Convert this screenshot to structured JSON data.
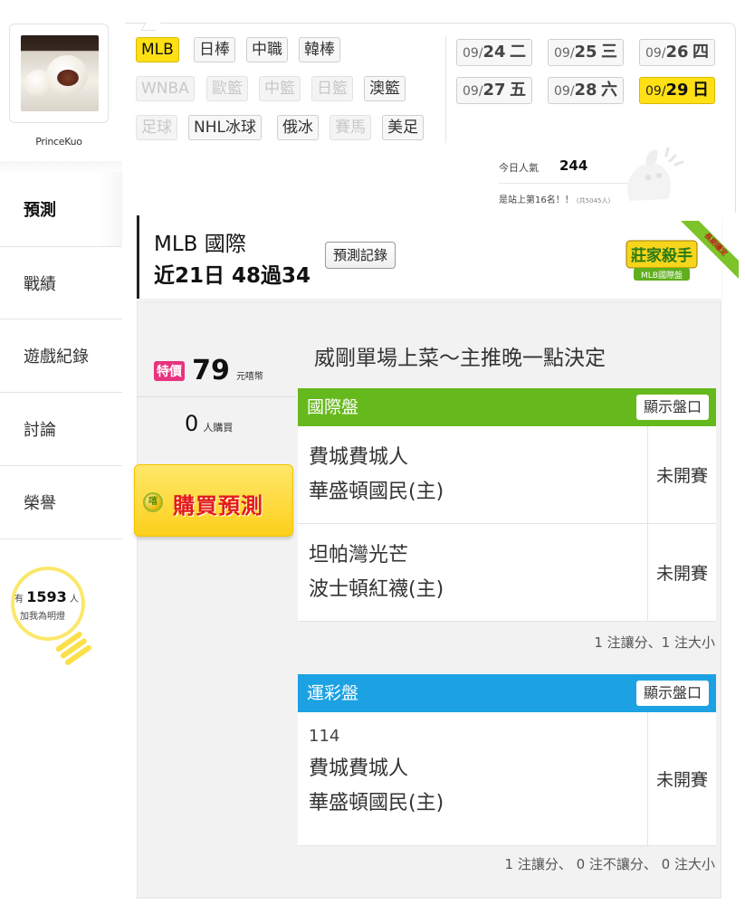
{
  "user": {
    "name": "PrinceKuo"
  },
  "nav": {
    "predict": "預測",
    "record": "戰績",
    "gamelog": "遊戲紀錄",
    "discuss": "討論",
    "honor": "榮譽"
  },
  "fans": {
    "prefix": "有",
    "count": "1593",
    "suffix": "人",
    "caption": "加我為明燈"
  },
  "categories": {
    "mlb": "MLB",
    "npb": "日棒",
    "cpbl": "中職",
    "kbo": "韓棒",
    "wnba": "WNBA",
    "euro_bb": "歐籃",
    "cn_bb": "中籃",
    "jp_bb": "日籃",
    "au_bb": "澳籃",
    "soccer": "足球",
    "nhl": "NHL冰球",
    "khl": "俄冰",
    "horse": "賽馬",
    "nfl": "美足"
  },
  "dates": [
    {
      "md": "09/",
      "d": "24",
      "wd": "二"
    },
    {
      "md": "09/",
      "d": "25",
      "wd": "三"
    },
    {
      "md": "09/",
      "d": "26",
      "wd": "四"
    },
    {
      "md": "09/",
      "d": "27",
      "wd": "五"
    },
    {
      "md": "09/",
      "d": "28",
      "wd": "六"
    },
    {
      "md": "09/",
      "d": "29",
      "wd": "日"
    }
  ],
  "popularity": {
    "label": "今日人氣",
    "value": "244",
    "rank_text": "是站上第16名！！",
    "rank_total": "(共5045人)"
  },
  "header": {
    "league": "MLB 國際",
    "record": "近21日 48過34",
    "history_button": "預測記錄",
    "badge_main": "莊家殺手",
    "badge_sub": "MLB國際盤",
    "badge_ribbon": "長期穩定"
  },
  "offer": {
    "sale_tag": "特價",
    "price": "79",
    "price_unit": "元嘻幣",
    "buyers": "0",
    "buyers_unit": "人購買",
    "buy_button": "購買預測",
    "coin_glyph": "嘻"
  },
  "pick_title": "威剛單場上菜～主推晚一點決定",
  "intl_market": {
    "title": "國際盤",
    "show_button": "顯示盤口",
    "games": [
      {
        "away": "費城費城人",
        "home": "華盛頓國民(主)",
        "status": "未開賽"
      },
      {
        "away": "坦帕灣光芒",
        "home": "波士頓紅襪(主)",
        "status": "未開賽"
      }
    ],
    "summary": "1 注讓分、1 注大小"
  },
  "lottery_market": {
    "title": "運彩盤",
    "show_button": "顯示盤口",
    "games": [
      {
        "id": "114",
        "away": "費城費城人",
        "home": "華盛頓國民(主)",
        "status": "未開賽"
      }
    ],
    "summary": "1 注讓分、 0 注不讓分、 0 注大小"
  },
  "colors": {
    "accent_yellow": "#ffe014",
    "sale_pink": "#e8337e",
    "intl_green": "#66b91c",
    "lottery_blue": "#1ca2e3",
    "buy_red": "#e21b1b"
  },
  "icons": {
    "avatar": "food-photo-avatar",
    "fans": "lightbulb-icon",
    "coin": "coin-icon",
    "mascot": "mascot-icon",
    "badge": "award-badge-icon"
  }
}
